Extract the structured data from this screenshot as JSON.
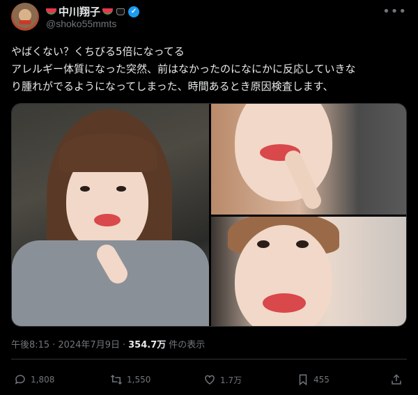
{
  "author": {
    "display_name": "中川翔子",
    "handle": "@shoko55mmts",
    "verified": true,
    "name_emojis": [
      "watermelon-icon",
      "watermelon-icon",
      "black-cat-icon"
    ]
  },
  "tweet": {
    "lines": [
      "やばくない？くちびる5倍になってる",
      "アレルギー体質になった突然、前はなかったのになにかに反応していきな",
      "り腫れがでるようになってしまった、時間あるとき原因検査します、"
    ]
  },
  "media": {
    "photo_count": 3
  },
  "meta": {
    "time": "午後8:15",
    "separator": "·",
    "date": "2024年7月9日",
    "views": "354.7万",
    "views_suffix": "件の表示"
  },
  "actions": {
    "replies": "1,808",
    "reposts": "1,550",
    "likes": "1.7万",
    "bookmarks": "455"
  },
  "colors": {
    "background": "#000000",
    "text": "#e7e9ea",
    "secondary": "#71767b",
    "verified": "#1d9bf0",
    "border": "#2f3336"
  }
}
